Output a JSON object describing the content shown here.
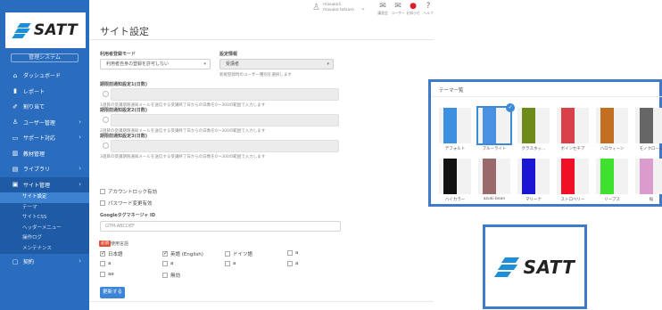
{
  "brand": {
    "name": "SATT"
  },
  "sidebar": {
    "system_tag": "管理システム",
    "items": [
      {
        "label": "ダッシュボード",
        "icon": "home-icon",
        "glyph": "⌂",
        "chevron": false
      },
      {
        "label": "レポート",
        "icon": "bar-chart-icon",
        "glyph": "▮",
        "chevron": false
      },
      {
        "label": "割り当て",
        "icon": "pin-icon",
        "glyph": "✐",
        "chevron": false
      },
      {
        "label": "ユーザー管理",
        "icon": "user-icon",
        "glyph": "♙",
        "chevron": true
      },
      {
        "label": "サポート対応",
        "icon": "chat-icon",
        "glyph": "▭",
        "chevron": true
      },
      {
        "label": "教材管理",
        "icon": "book-icon",
        "glyph": "▥",
        "chevron": false
      },
      {
        "label": "ライブラリ",
        "icon": "library-icon",
        "glyph": "▤",
        "chevron": true
      },
      {
        "label": "サイト管理",
        "icon": "site-icon",
        "glyph": "▣",
        "chevron": true
      }
    ],
    "sub_items": [
      "サイト設定",
      "テーマ",
      "サイトCSS",
      "ヘッダーメニュー",
      "操作ログ",
      "メンテナンス"
    ],
    "last_item": {
      "label": "契約",
      "icon": "document-icon",
      "glyph": "▢"
    }
  },
  "topbar": {
    "user_line1": "masuko1",
    "user_line2": "masuko tatsuro",
    "icons": [
      {
        "label": "講習会",
        "icon": "mail-icon",
        "glyph": "✉"
      },
      {
        "label": "ユーザー",
        "icon": "inbox-icon",
        "glyph": "✉"
      },
      {
        "label": "お知らせ",
        "icon": "bell-icon",
        "glyph": "●"
      },
      {
        "label": "ヘルプ",
        "icon": "help-icon",
        "glyph": "?"
      }
    ]
  },
  "page": {
    "title": "サイト設定",
    "mode_label": "利用者登録モード",
    "mode_value": "利用者自身の登録を許可しない",
    "settings_label": "設定情報",
    "settings_value": "受講者",
    "settings_help": "新規登録時のユーザー種別を選択します",
    "notify": [
      {
        "label": "期限前通知設定1(日数)",
        "help": "1週目の受講期限通知メールを送信する受講終了日からの日数を0〜300の範囲で入力します"
      },
      {
        "label": "期限前通知設定2(日数)",
        "help": "2週目の受講期限通知メールを送信する受講終了日からの日数を0〜300の範囲で入力します"
      },
      {
        "label": "期限前通知設定3(日数)",
        "help": "3週目の受講期限通知メールを送信する受講終了日からの日数を0〜300の範囲で入力します"
      }
    ],
    "account_lock": "アカウントロック有効",
    "password_change": "パスワード変更有効",
    "gtm_label": "Googleタグマネージャ ID",
    "gtm_placeholder": "GTM-ABCDEF",
    "lang_badge": "必須",
    "lang_label": "使用言語",
    "languages": [
      {
        "label": "日本語",
        "checked": true
      },
      {
        "label": "英語 (English)",
        "checked": true
      },
      {
        "label": "ドイツ語",
        "checked": false
      },
      {
        "label": "a",
        "checked": false
      },
      {
        "label": "a",
        "checked": false
      },
      {
        "label": "a",
        "checked": false
      },
      {
        "label": "a",
        "checked": false
      },
      {
        "label": "a",
        "checked": false
      },
      {
        "label": "ae",
        "checked": false
      },
      {
        "label": "無効",
        "checked": false
      }
    ],
    "save_button": "更新する"
  },
  "theme_panel": {
    "title": "テーマ一覧",
    "themes": [
      {
        "label": "デフォルト",
        "color": "#3d8fe0",
        "selected": false
      },
      {
        "label": "ブルーライト",
        "color": "#4a90e2",
        "selected": true
      },
      {
        "label": "グラスホッ…",
        "color": "#6e8b1a",
        "selected": false
      },
      {
        "label": "ボインセチア",
        "color": "#d9404a",
        "selected": false
      },
      {
        "label": "ハロウィーン",
        "color": "#c07020",
        "selected": false
      },
      {
        "label": "モノクローム",
        "color": "#666666",
        "selected": false
      },
      {
        "label": "ハイカラー",
        "color": "#111111",
        "selected": false
      },
      {
        "label": "azuki bean",
        "color": "#9a6a6a",
        "selected": false
      },
      {
        "label": "マリーナ",
        "color": "#1a16d4",
        "selected": false
      },
      {
        "label": "ストロベリー",
        "color": "#f01026",
        "selected": false
      },
      {
        "label": "リーブス",
        "color": "#3ee22e",
        "selected": false
      },
      {
        "label": "桜",
        "color": "#d99ccc",
        "selected": false
      }
    ]
  }
}
